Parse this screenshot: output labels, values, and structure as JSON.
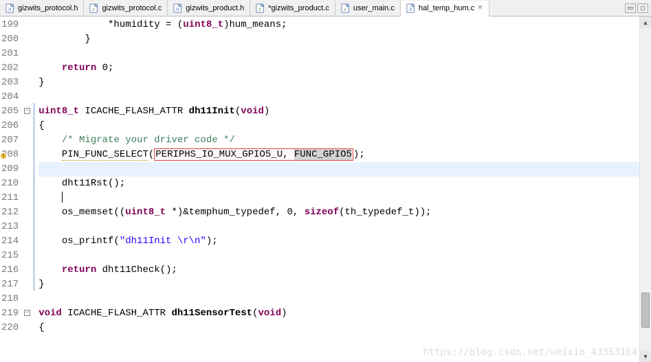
{
  "tabs": [
    {
      "icon": "h",
      "label": "gizwits_protocol.h",
      "dirty": false,
      "active": false
    },
    {
      "icon": "c",
      "label": "gizwits_protocol.c",
      "dirty": false,
      "active": false
    },
    {
      "icon": "h",
      "label": "gizwits_product.h",
      "dirty": false,
      "active": false
    },
    {
      "icon": "c",
      "label": "*gizwits_product.c",
      "dirty": true,
      "active": false
    },
    {
      "icon": "c",
      "label": "user_main.c",
      "dirty": false,
      "active": false
    },
    {
      "icon": "h",
      "label": "hal_temp_hum.c",
      "dirty": false,
      "active": true
    }
  ],
  "window_buttons": {
    "min": "▭",
    "max": "□"
  },
  "lines": [
    {
      "n": 199,
      "indent": "            ",
      "tokens": [
        [
          "",
          "*humidity = ("
        ],
        [
          "k",
          "uint8_t"
        ],
        [
          "",
          ")hum_means;"
        ]
      ]
    },
    {
      "n": 200,
      "indent": "        ",
      "tokens": [
        [
          "",
          "}"
        ]
      ]
    },
    {
      "n": 201,
      "indent": "",
      "tokens": []
    },
    {
      "n": 202,
      "indent": "    ",
      "tokens": [
        [
          "k",
          "return"
        ],
        [
          "",
          " 0;"
        ]
      ]
    },
    {
      "n": 203,
      "indent": "",
      "tokens": [
        [
          "",
          "}"
        ]
      ]
    },
    {
      "n": 204,
      "indent": "",
      "tokens": []
    },
    {
      "n": 205,
      "indent": "",
      "tokens": [
        [
          "k",
          "uint8_t"
        ],
        [
          "",
          " ICACHE_FLASH_ATTR "
        ],
        [
          "fn",
          "dh11Init"
        ],
        [
          "",
          "("
        ],
        [
          "k",
          "void"
        ],
        [
          "",
          ")"
        ]
      ],
      "fold": true,
      "change": true
    },
    {
      "n": 206,
      "indent": "",
      "tokens": [
        [
          "",
          "{"
        ]
      ],
      "change": true
    },
    {
      "n": 207,
      "indent": "    ",
      "tokens": [
        [
          "cm",
          "/* Migrate your driver code */"
        ]
      ],
      "change": true
    },
    {
      "n": 208,
      "indent": "    ",
      "tokens": [
        [
          "sq",
          "PIN_FUNC_SELECT"
        ],
        [
          "",
          "("
        ],
        [
          "box",
          "PERIPHS_IO_MUX_GPIO5_U, "
        ],
        [
          "boxsel",
          "FUNC_GPIO5"
        ],
        [
          "",
          ");"
        ]
      ],
      "marker": "warn",
      "change": true
    },
    {
      "n": 209,
      "indent": "",
      "tokens": [],
      "current": true,
      "change": true
    },
    {
      "n": 210,
      "indent": "    ",
      "tokens": [
        [
          "",
          "dht11Rst();"
        ]
      ],
      "change": true
    },
    {
      "n": 211,
      "indent": "    ",
      "tokens": [
        [
          "cur",
          "  "
        ]
      ],
      "change": true
    },
    {
      "n": 212,
      "indent": "    ",
      "tokens": [
        [
          "",
          "os_memset(("
        ],
        [
          "k",
          "uint8_t"
        ],
        [
          "",
          " *)&temphum_typedef, 0, "
        ],
        [
          "k",
          "sizeof"
        ],
        [
          "",
          "(th_typedef_t));"
        ]
      ],
      "change": true
    },
    {
      "n": 213,
      "indent": "",
      "tokens": [],
      "change": true
    },
    {
      "n": 214,
      "indent": "    ",
      "tokens": [
        [
          "",
          "os_printf("
        ],
        [
          "str",
          "\"dh11Init \\r\\n\""
        ],
        [
          "",
          ");"
        ]
      ],
      "change": true
    },
    {
      "n": 215,
      "indent": "",
      "tokens": [],
      "change": true
    },
    {
      "n": 216,
      "indent": "    ",
      "tokens": [
        [
          "k",
          "return"
        ],
        [
          "",
          " dht11Check();"
        ]
      ],
      "change": true
    },
    {
      "n": 217,
      "indent": "",
      "tokens": [
        [
          "",
          "}"
        ]
      ],
      "change": true
    },
    {
      "n": 218,
      "indent": "",
      "tokens": []
    },
    {
      "n": 219,
      "indent": "",
      "tokens": [
        [
          "k",
          "void"
        ],
        [
          "",
          " ICACHE_FLASH_ATTR "
        ],
        [
          "fn",
          "dh11SensorTest"
        ],
        [
          "",
          "("
        ],
        [
          "k",
          "void"
        ],
        [
          "",
          ")"
        ]
      ],
      "fold": true
    },
    {
      "n": 220,
      "indent": "",
      "tokens": [
        [
          "",
          "{"
        ]
      ]
    }
  ],
  "scrollbar": {
    "thumb_top_pct": 82,
    "thumb_height_pct": 11
  },
  "watermark": "https://blog.csdn.net/weixin_43353164"
}
